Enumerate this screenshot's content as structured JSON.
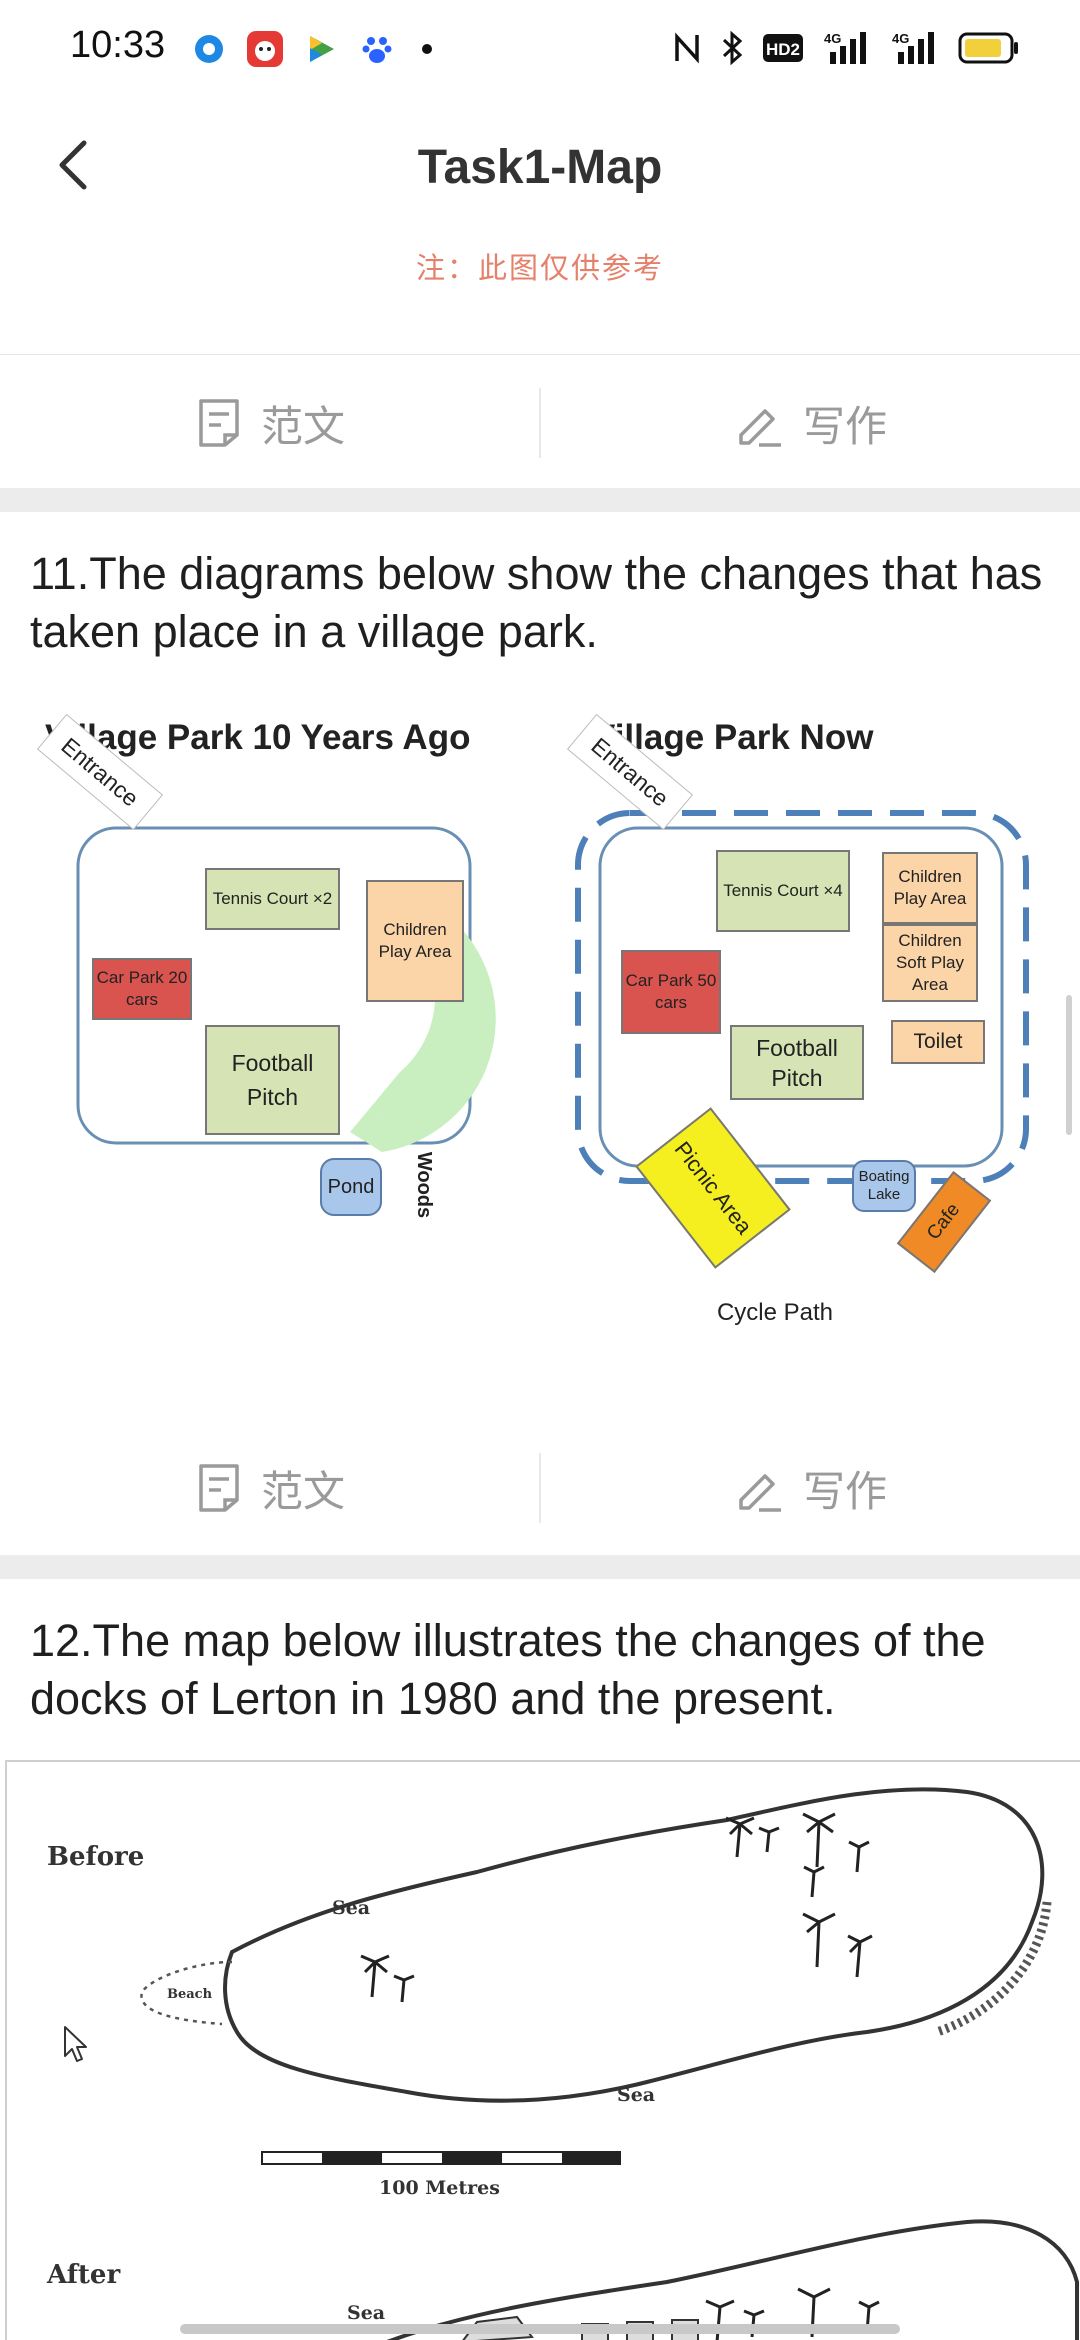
{
  "status_bar": {
    "time": "10:33",
    "app_icons": [
      "record-app-icon",
      "mascot-app-icon",
      "video-app-icon",
      "baidu-app-icon"
    ],
    "right_icons": [
      "nfc-icon",
      "bluetooth-icon",
      "hd-icon",
      "signal-4g-icon",
      "signal-4g-icon",
      "battery-icon"
    ],
    "hd_label": "HD2",
    "net_label": "4G"
  },
  "header": {
    "title": "Task1-Map",
    "note": "注：此图仅供参考"
  },
  "actions": {
    "sample_label": "范文",
    "write_label": "写作"
  },
  "question11": {
    "text": "11.The diagrams below show the changes that has taken place in a village park.",
    "before": {
      "title": "Village Park 10 Years Ago",
      "entrance": "Entrance",
      "tennis": "Tennis Court ×2",
      "children": "Children Play Area",
      "carpark": "Car Park 20 cars",
      "football": "Football Pitch",
      "pond": "Pond",
      "woods": "Woods"
    },
    "after": {
      "title": "Village Park Now",
      "entrance": "Entrance",
      "tennis": "Tennis Court ×4",
      "children_play": "Children Play Area",
      "children_soft": "Children Soft Play Area",
      "carpark": "Car Park 50 cars",
      "football": "Football Pitch",
      "toilet": "Toilet",
      "picnic": "Picnic Area",
      "boating": "Boating Lake",
      "cafe": "Cafe",
      "cycle_path": "Cycle Path"
    }
  },
  "question12": {
    "text": "12.The map below illustrates the changes of the docks of Lerton in 1980 and the present.",
    "before_label": "Before",
    "after_label": "After",
    "sea_label": "Sea",
    "beach_label": "Beach",
    "scale_label": "100 Metres"
  },
  "colors": {
    "note": "#e5806a",
    "action_text": "#9a9a9a",
    "band": "#ececec",
    "park_border": "#6a8fb5",
    "green_box": "#d6e4b5",
    "orange_box": "#fbd4a8",
    "red_box": "#d9534f",
    "pond": "#a9c7ea",
    "woods": "#c9efc0",
    "picnic": "#f5ef1f",
    "cafe": "#f08a26"
  }
}
